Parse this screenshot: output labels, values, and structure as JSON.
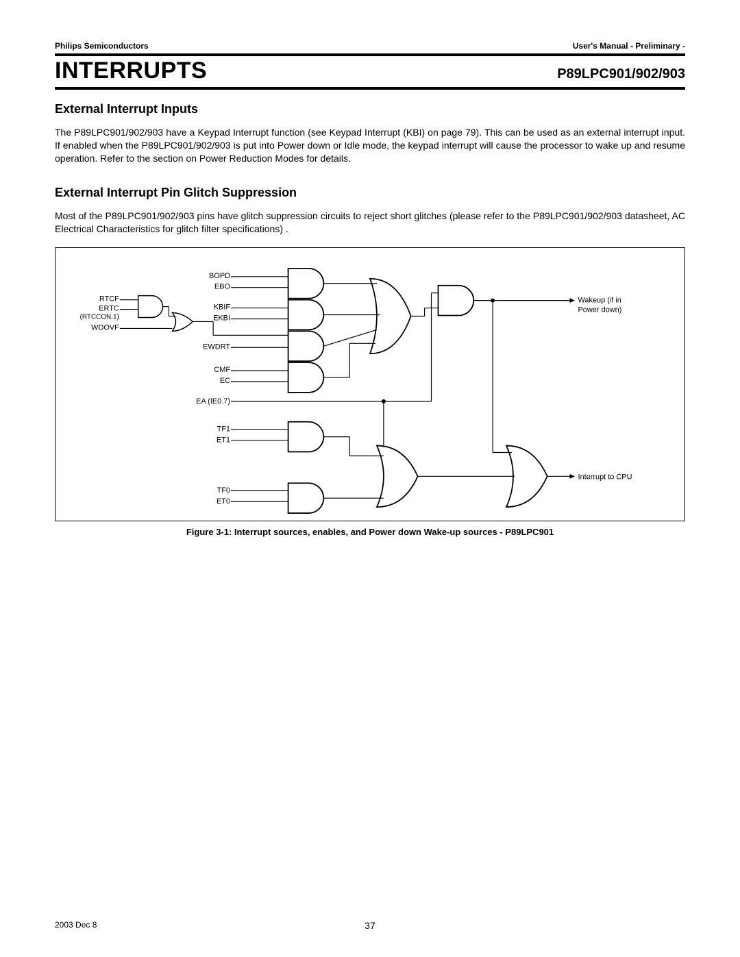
{
  "header": {
    "left": "Philips Semiconductors",
    "right": "User's Manual - Preliminary -"
  },
  "title_bar": {
    "chapter": "INTERRUPTS",
    "part": "P89LPC901/902/903"
  },
  "section1": {
    "heading": "External Interrupt Inputs",
    "body": "The P89LPC901/902/903 have a Keypad Interrupt function (see Keypad Interrupt (KBI) on page 79). This can be used as an external interrupt input. If enabled when the P89LPC901/902/903 is put into Power down or Idle mode, the keypad interrupt will cause the processor to wake up and resume operation. Refer to the section on Power Reduction Modes for details."
  },
  "section2": {
    "heading": "External Interrupt Pin Glitch Suppression",
    "body": "Most of the P89LPC901/902/903 pins have glitch suppression circuits to reject short glitches (please refer to the P89LPC901/902/903 datasheet, AC Electrical Characteristics for glitch filter specifications) ."
  },
  "diagram": {
    "signals": {
      "RTCF": "RTCF",
      "ERTC": "ERTC",
      "RTCCON1": "(RTCCON.1)",
      "WDOVF": "WDOVF",
      "BOPD": "BOPD",
      "EBO": "EBO",
      "KBIF": "KBIF",
      "EKBI": "EKBI",
      "EWDRT": "EWDRT",
      "CMF": "CMF",
      "EC": "EC",
      "EA": "EA (IE0.7)",
      "TF1": "TF1",
      "ET1": "ET1",
      "TF0": "TF0",
      "ET0": "ET0"
    },
    "outputs": {
      "wakeup1": "Wakeup (if in",
      "wakeup2": "Power down)",
      "intcpu": "Interrupt to CPU"
    }
  },
  "caption": "Figure 3-1: Interrupt sources, enables, and Power down Wake-up sources - P89LPC901",
  "footer": {
    "date": "2003 Dec 8",
    "page": "37"
  }
}
